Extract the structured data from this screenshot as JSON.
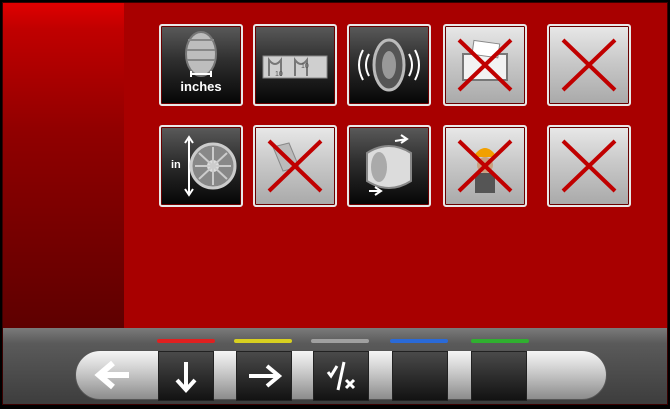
{
  "tiles": {
    "row1": [
      {
        "name": "tire-width-inches-tile",
        "label": "inches",
        "disabled": false
      },
      {
        "name": "balance-weights-tile",
        "label": "",
        "disabled": false
      },
      {
        "name": "wheel-vibration-tile",
        "label": "",
        "disabled": false
      },
      {
        "name": "printer-tile",
        "label": "",
        "disabled": true
      },
      {
        "name": "empty-slot-tile",
        "label": "",
        "disabled": true
      }
    ],
    "row2": [
      {
        "name": "rim-diameter-inches-tile",
        "label": "in",
        "disabled": false
      },
      {
        "name": "rim-measure-tile",
        "label": "",
        "disabled": true
      },
      {
        "name": "tire-rotation-tile",
        "label": "",
        "disabled": false
      },
      {
        "name": "operator-tile",
        "label": "",
        "disabled": true
      },
      {
        "name": "empty-slot-tile-2",
        "label": "",
        "disabled": true
      }
    ]
  },
  "toolbar": {
    "color_bars": [
      "#e02020",
      "#d8d020",
      "#a0a0a0",
      "#2a6ad8",
      "#30b030"
    ],
    "keys": [
      "back-arrow-icon",
      "arrow-down-icon",
      "arrow-right-icon",
      "accept-cancel-icon",
      "blank-icon",
      "blank-icon"
    ]
  }
}
